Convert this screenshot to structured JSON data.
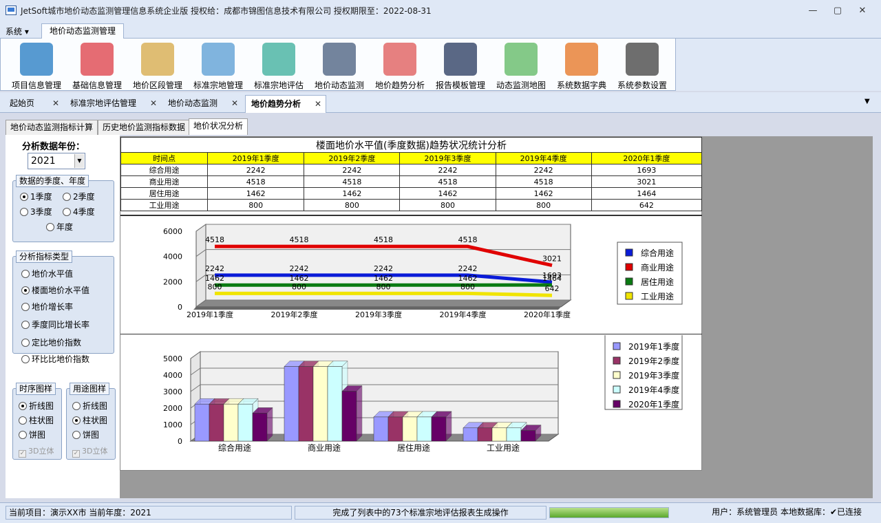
{
  "window": {
    "title": "JetSoft城市地价动态监测管理信息系统企业版   授权给：成都市锦图信息技术有限公司   授权期限至：2022-08-31",
    "min": "—",
    "max": "▢",
    "close": "✕"
  },
  "menu": {
    "system": "系统 ▾",
    "active_tab": "地价动态监测管理"
  },
  "ribbon": [
    {
      "label": "项目信息管理",
      "icon": "globe-computer-icon",
      "color": "#3a88c9"
    },
    {
      "label": "基础信息管理",
      "icon": "clipboard-pencil-icon",
      "color": "#e0525a"
    },
    {
      "label": "地价区段管理",
      "icon": "map-magnifier-icon",
      "color": "#d9b25b"
    },
    {
      "label": "标准宗地管理",
      "icon": "map-pin-icon",
      "color": "#6aa7d8"
    },
    {
      "label": "标准宗地评估",
      "icon": "house-dollar-icon",
      "color": "#4fb6a6"
    },
    {
      "label": "地价动态监测",
      "icon": "monitor-chart-icon",
      "color": "#5a6e8c"
    },
    {
      "label": "地价趋势分析",
      "icon": "clipboard-chart-icon",
      "color": "#e26a6a"
    },
    {
      "label": "报告模板管理",
      "icon": "laptop-gear-icon",
      "color": "#3d4d70"
    },
    {
      "label": "动态监测地图",
      "icon": "map-search-icon",
      "color": "#6fbf73"
    },
    {
      "label": "系统数据字典",
      "icon": "book-shelf-icon",
      "color": "#e8823a"
    },
    {
      "label": "系统参数设置",
      "icon": "gears-icon",
      "color": "#555555"
    }
  ],
  "doc_tabs": [
    {
      "label": "起始页",
      "x": 0,
      "w": 86
    },
    {
      "label": "标准宗地评估管理",
      "x": 88,
      "w": 140
    },
    {
      "label": "地价动态监测",
      "x": 230,
      "w": 116
    },
    {
      "label": "地价趋势分析",
      "x": 350,
      "w": 118,
      "active": true
    }
  ],
  "doc_tabs_close": "✕",
  "doc_tabs_dropdown": "▼",
  "sub_tabs": [
    "地价动态监测指标计算",
    "历史地价监测指标数据",
    "地价状况分析"
  ],
  "left": {
    "year_label": "分析数据年份：",
    "year_value": "2021",
    "season_group": {
      "legend": "数据的季度、年度",
      "options": [
        "1季度",
        "2季度",
        "3季度",
        "4季度",
        "年度"
      ],
      "selected": "1季度"
    },
    "index_group": {
      "legend": "分析指标类型",
      "options": [
        "地价水平值",
        "楼面地价水平值",
        "地价增长率",
        "季度同比增长率",
        "定比地价指数",
        "环比比地价指数"
      ],
      "selected": "楼面地价水平值"
    },
    "time_group": {
      "legend": "时序图样",
      "options": [
        "折线图",
        "柱状图",
        "饼图"
      ],
      "selected": "折线图",
      "check": "3D立体"
    },
    "use_group": {
      "legend": "用途图样",
      "options": [
        "折线图",
        "柱状图",
        "饼图"
      ],
      "selected": "柱状图",
      "check": "3D立体"
    }
  },
  "table": {
    "title": "楼面地价水平值(季度数据)趋势状况统计分析",
    "headers": [
      "时间点",
      "2019年1季度",
      "2019年2季度",
      "2019年3季度",
      "2019年4季度",
      "2020年1季度"
    ],
    "rows": [
      [
        "综合用途",
        "2242",
        "2242",
        "2242",
        "2242",
        "1693"
      ],
      [
        "商业用途",
        "4518",
        "4518",
        "4518",
        "4518",
        "3021"
      ],
      [
        "居住用途",
        "1462",
        "1462",
        "1462",
        "1462",
        "1464"
      ],
      [
        "工业用途",
        "800",
        "800",
        "800",
        "800",
        "642"
      ]
    ]
  },
  "chart_data": [
    {
      "type": "line",
      "categories": [
        "2019年1季度",
        "2019年2季度",
        "2019年3季度",
        "2019年4季度",
        "2020年1季度"
      ],
      "ylim": [
        0,
        6000
      ],
      "yticks": [
        0,
        2000,
        4000,
        6000
      ],
      "grid": true,
      "legend": "right",
      "series": [
        {
          "name": "综合用途",
          "values": [
            2242,
            2242,
            2242,
            2242,
            1693
          ],
          "color": "#0a1bd8"
        },
        {
          "name": "商业用途",
          "values": [
            4518,
            4518,
            4518,
            4518,
            3021
          ],
          "color": "#e00000"
        },
        {
          "name": "居住用途",
          "values": [
            1462,
            1462,
            1462,
            1462,
            1464
          ],
          "color": "#0a7a12"
        },
        {
          "name": "工业用途",
          "values": [
            800,
            800,
            800,
            800,
            642
          ],
          "color": "#f0e400"
        }
      ]
    },
    {
      "type": "bar",
      "categories": [
        "综合用途",
        "商业用途",
        "居住用途",
        "工业用途"
      ],
      "ylim": [
        0,
        5000
      ],
      "yticks": [
        0,
        1000,
        2000,
        3000,
        4000,
        5000
      ],
      "grid": true,
      "legend": "right",
      "series": [
        {
          "name": "2019年1季度",
          "values": [
            2242,
            4518,
            1462,
            800
          ],
          "color": "#9999ff"
        },
        {
          "name": "2019年2季度",
          "values": [
            2242,
            4518,
            1462,
            800
          ],
          "color": "#993366"
        },
        {
          "name": "2019年3季度",
          "values": [
            2242,
            4518,
            1462,
            800
          ],
          "color": "#ffffcc"
        },
        {
          "name": "2019年4季度",
          "values": [
            2242,
            4518,
            1462,
            800
          ],
          "color": "#ccffff"
        },
        {
          "name": "2020年1季度",
          "values": [
            1693,
            3021,
            1464,
            642
          ],
          "color": "#660066"
        }
      ]
    }
  ],
  "status": {
    "project": "当前项目：演示XX市   当前年度：2021",
    "message": "完成了列表中的73个标准宗地评估报表生成操作",
    "user": "用户：系统管理员  本地数据库：✔已连接"
  }
}
